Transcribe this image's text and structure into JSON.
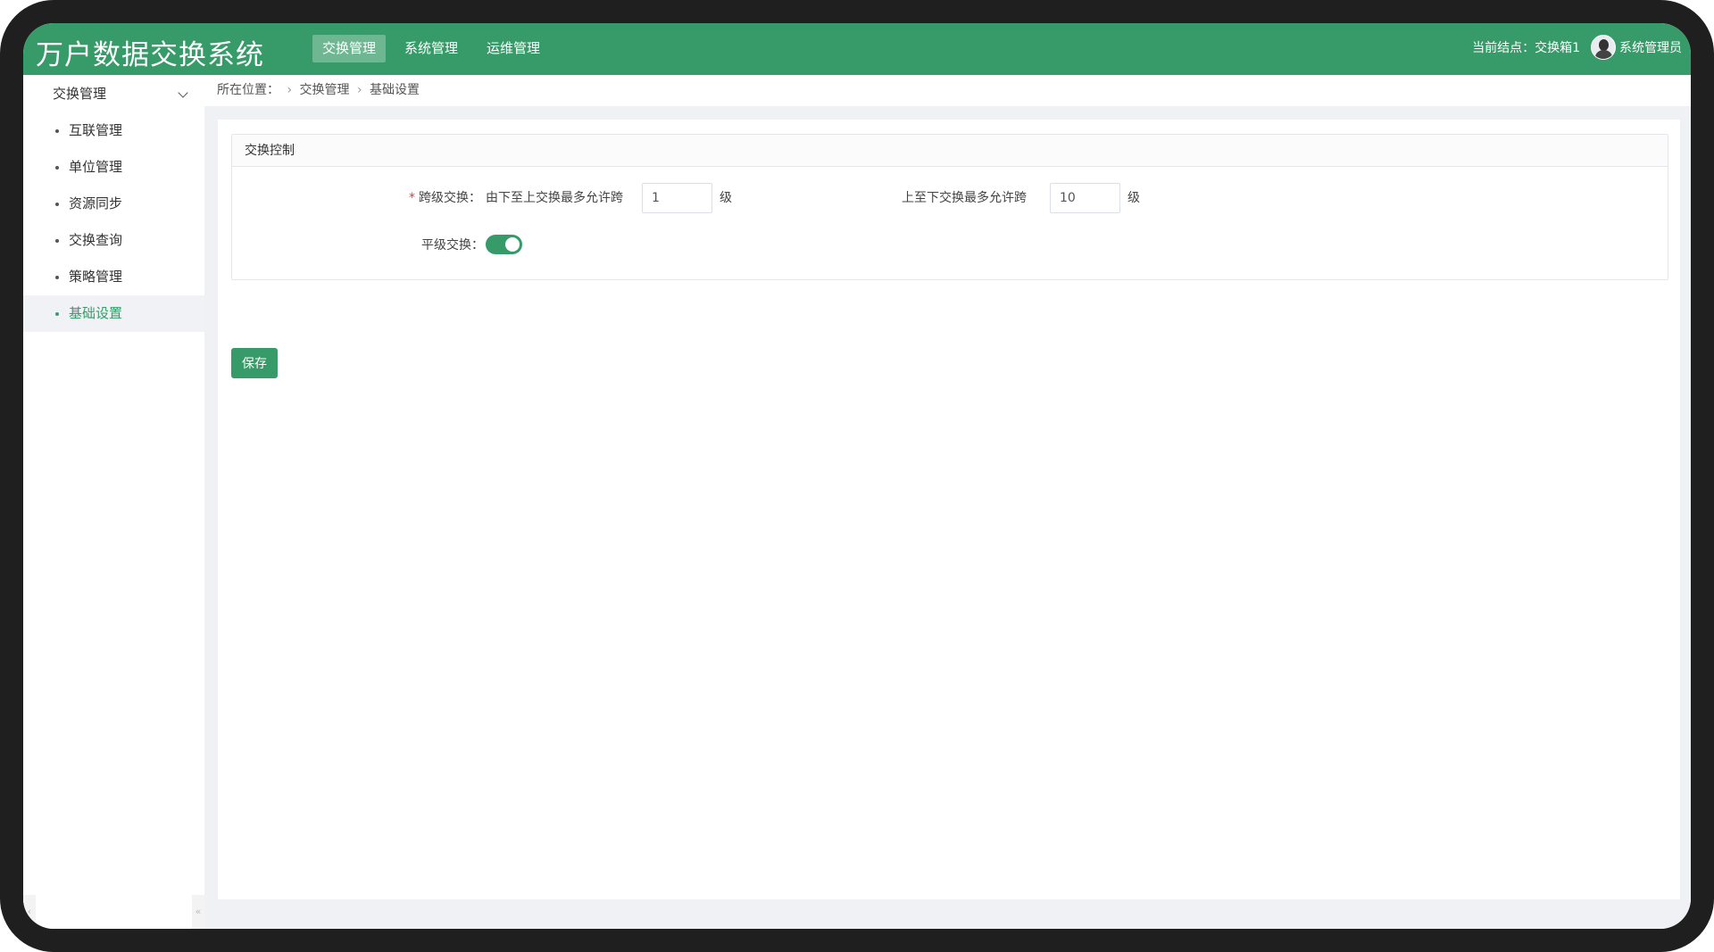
{
  "header": {
    "app_title": "万户数据交换系统",
    "nav": [
      {
        "label": "交换管理",
        "active": true
      },
      {
        "label": "系统管理",
        "active": false
      },
      {
        "label": "运维管理",
        "active": false
      }
    ],
    "current_node": "当前结点：交换箱1",
    "user_name": "系统管理员"
  },
  "sidebar": {
    "group_label": "交换管理",
    "items": [
      {
        "label": "互联管理",
        "active": false
      },
      {
        "label": "单位管理",
        "active": false
      },
      {
        "label": "资源同步",
        "active": false
      },
      {
        "label": "交换查询",
        "active": false
      },
      {
        "label": "策略管理",
        "active": false
      },
      {
        "label": "基础设置",
        "active": true
      }
    ]
  },
  "breadcrumb": {
    "prefix": "所在位置：",
    "items": [
      "交换管理",
      "基础设置"
    ]
  },
  "form": {
    "section_title": "交换控制",
    "cross_level": {
      "required_mark": "*",
      "label": "跨级交换：",
      "up_label": "由下至上交换最多允许跨",
      "up_value": "1",
      "up_unit": "级",
      "down_label": "上至下交换最多允许跨",
      "down_value": "10",
      "down_unit": "级"
    },
    "same_level": {
      "label": "平级交换：",
      "enabled": true
    },
    "save_label": "保存"
  },
  "colors": {
    "primary": "#369b68",
    "required": "#e53935",
    "content_bg": "#eff1f4"
  }
}
